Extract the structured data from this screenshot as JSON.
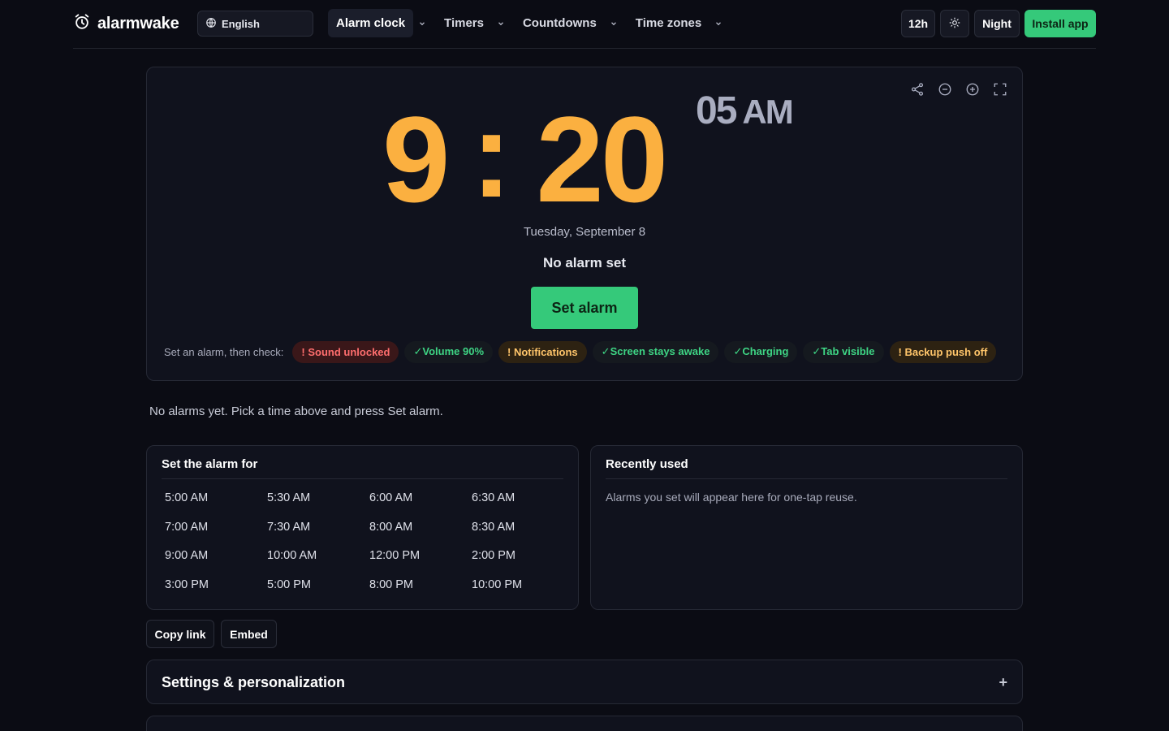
{
  "header": {
    "brand": "alarmwake",
    "brand_icon": "alarm-clock-icon",
    "language": "English",
    "nav": [
      {
        "label": "Alarm clock",
        "active": true
      },
      {
        "label": "Timers",
        "active": false
      },
      {
        "label": "Countdowns",
        "active": false
      },
      {
        "label": "Time zones",
        "active": false
      }
    ],
    "format_label": "12h",
    "theme_icon": "sun-icon",
    "night_label": "Night",
    "install_label": "Install app"
  },
  "clock": {
    "hours": "9",
    "separator": ":",
    "minutes": "20",
    "seconds": "05",
    "ampm": "AM",
    "date": "Tuesday, September 8",
    "status": "No alarm set",
    "set_alarm_label": "Set alarm",
    "tools": [
      "share-icon",
      "zoom-out-icon",
      "zoom-in-icon",
      "fullscreen-icon"
    ],
    "checks_label": "Set an alarm, then check:",
    "checks": [
      {
        "text": "! Sound unlocked",
        "state": "bad"
      },
      {
        "text": "✓Volume 90%",
        "state": "ok"
      },
      {
        "text": "! Notifications",
        "state": "warn"
      },
      {
        "text": "✓Screen stays awake",
        "state": "ok"
      },
      {
        "text": "✓Charging",
        "state": "ok"
      },
      {
        "text": "✓Tab visible",
        "state": "ok"
      },
      {
        "text": "! Backup push off",
        "state": "warn"
      }
    ]
  },
  "alarms_empty": "No alarms yet. Pick a time above and press Set alarm.",
  "quick_times": {
    "title": "Set the alarm for",
    "times": [
      "5:00 AM",
      "5:30 AM",
      "6:00 AM",
      "6:30 AM",
      "7:00 AM",
      "7:30 AM",
      "8:00 AM",
      "8:30 AM",
      "9:00 AM",
      "10:00 AM",
      "12:00 PM",
      "2:00 PM",
      "3:00 PM",
      "5:00 PM",
      "8:00 PM",
      "10:00 PM"
    ]
  },
  "recent": {
    "title": "Recently used",
    "empty": "Alarms you set will appear here for one-tap reuse."
  },
  "actions": {
    "copy_link": "Copy link",
    "embed": "Embed"
  },
  "settings": {
    "title": "Settings & personalization",
    "toggle": "+"
  },
  "colors": {
    "background": "#0b0c14",
    "card": "#10121d",
    "accent_orange": "#fbb040",
    "accent_green": "#35c97a",
    "error": "#ff6e6e",
    "warning": "#ffc56a"
  }
}
